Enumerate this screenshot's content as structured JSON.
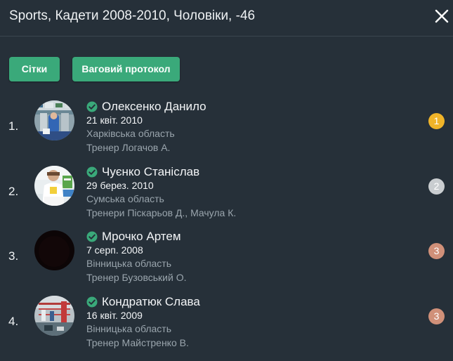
{
  "header": {
    "title": "Sports, Кадети 2008-2010, Чоловіки, -46"
  },
  "buttons": {
    "grids_label": "Сітки",
    "weight_protocol_label": "Ваговий протокол"
  },
  "colors": {
    "background": "#263039",
    "accent": "#3aa97a",
    "gold": "#f0b429",
    "silver": "#c9cdd0",
    "bronze": "#d09079"
  },
  "athletes": [
    {
      "rank": "1.",
      "name": "Олексенко Данило",
      "dob": "21 квіт. 2010",
      "region": "Харківська область",
      "coach": "Тренер Логачов А.",
      "medal": "1",
      "medal_color": "#f0b429",
      "verified_icon": "check-circle-icon"
    },
    {
      "rank": "2.",
      "name": "Чуєнко Станіслав",
      "dob": "29 берез. 2010",
      "region": "Сумська область",
      "coach": "Тренери Піскарьов Д.,  Мачула К.",
      "medal": "2",
      "medal_color": "#c9cdd0",
      "verified_icon": "check-circle-icon"
    },
    {
      "rank": "3.",
      "name": "Мрочко Артем",
      "dob": "7 серп. 2008",
      "region": "Вінницька область",
      "coach": "Тренер Бузовський О.",
      "medal": "3",
      "medal_color": "#d09079",
      "verified_icon": "check-circle-icon"
    },
    {
      "rank": "4.",
      "name": "Кондратюк Слава",
      "dob": "16 квіт. 2009",
      "region": "Вінницька область",
      "coach": "Тренер Майстренко В.",
      "medal": "3",
      "medal_color": "#d09079",
      "verified_icon": "check-circle-icon"
    }
  ]
}
